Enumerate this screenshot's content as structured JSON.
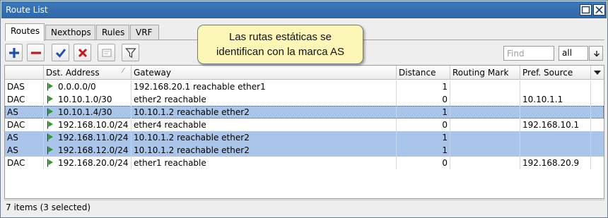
{
  "window": {
    "title": "Route List"
  },
  "tabs": [
    {
      "label": "Routes",
      "active": true
    },
    {
      "label": "Nexthops",
      "active": false
    },
    {
      "label": "Rules",
      "active": false
    },
    {
      "label": "VRF",
      "active": false
    }
  ],
  "toolbar": {
    "buttons": [
      "add-icon",
      "remove-icon",
      "enable-check-icon",
      "disable-x-icon",
      "comment-icon",
      "filter-icon"
    ],
    "find_placeholder": "Find",
    "filter_select_value": "all"
  },
  "callout": {
    "line1": "Las rutas estáticas se",
    "line2": "identifican con la marca AS"
  },
  "table": {
    "columns": [
      "",
      "Dst. Address",
      "Gateway",
      "Distance",
      "Routing Mark",
      "Pref. Source"
    ],
    "rows": [
      {
        "flags": "DAS",
        "dst": "0.0.0.0/0",
        "gateway": "192.168.20.1 reachable ether1",
        "distance": "1",
        "routing_mark": "",
        "pref_source": "",
        "selected": false
      },
      {
        "flags": "DAC",
        "dst": "10.10.1.0/30",
        "gateway": "ether2 reachable",
        "distance": "0",
        "routing_mark": "",
        "pref_source": "10.10.1.1",
        "selected": false
      },
      {
        "flags": "AS",
        "dst": "10.10.1.4/30",
        "gateway": "10.10.1.2 reachable ether2",
        "distance": "1",
        "routing_mark": "",
        "pref_source": "",
        "selected": true
      },
      {
        "flags": "DAC",
        "dst": "192.168.10.0/24",
        "gateway": "ether4 reachable",
        "distance": "0",
        "routing_mark": "",
        "pref_source": "192.168.10.1",
        "selected": false
      },
      {
        "flags": "AS",
        "dst": "192.168.11.0/24",
        "gateway": "10.10.1.2 reachable ether2",
        "distance": "1",
        "routing_mark": "",
        "pref_source": "",
        "selected": true
      },
      {
        "flags": "AS",
        "dst": "192.168.12.0/24",
        "gateway": "10.10.1.2 reachable ether2",
        "distance": "1",
        "routing_mark": "",
        "pref_source": "",
        "selected": true
      },
      {
        "flags": "DAC",
        "dst": "192.168.20.0/24",
        "gateway": "ether1 reachable",
        "distance": "0",
        "routing_mark": "",
        "pref_source": "192.168.20.9",
        "selected": false
      }
    ]
  },
  "status": {
    "text": "7 items (3 selected)"
  },
  "colors": {
    "titlebar": "#3d78b8",
    "selection": "#a9c6ea",
    "callout": "#fcf7b6",
    "add": "#1f4fb0",
    "remove": "#c81818",
    "flag": "#2e9a2e"
  }
}
